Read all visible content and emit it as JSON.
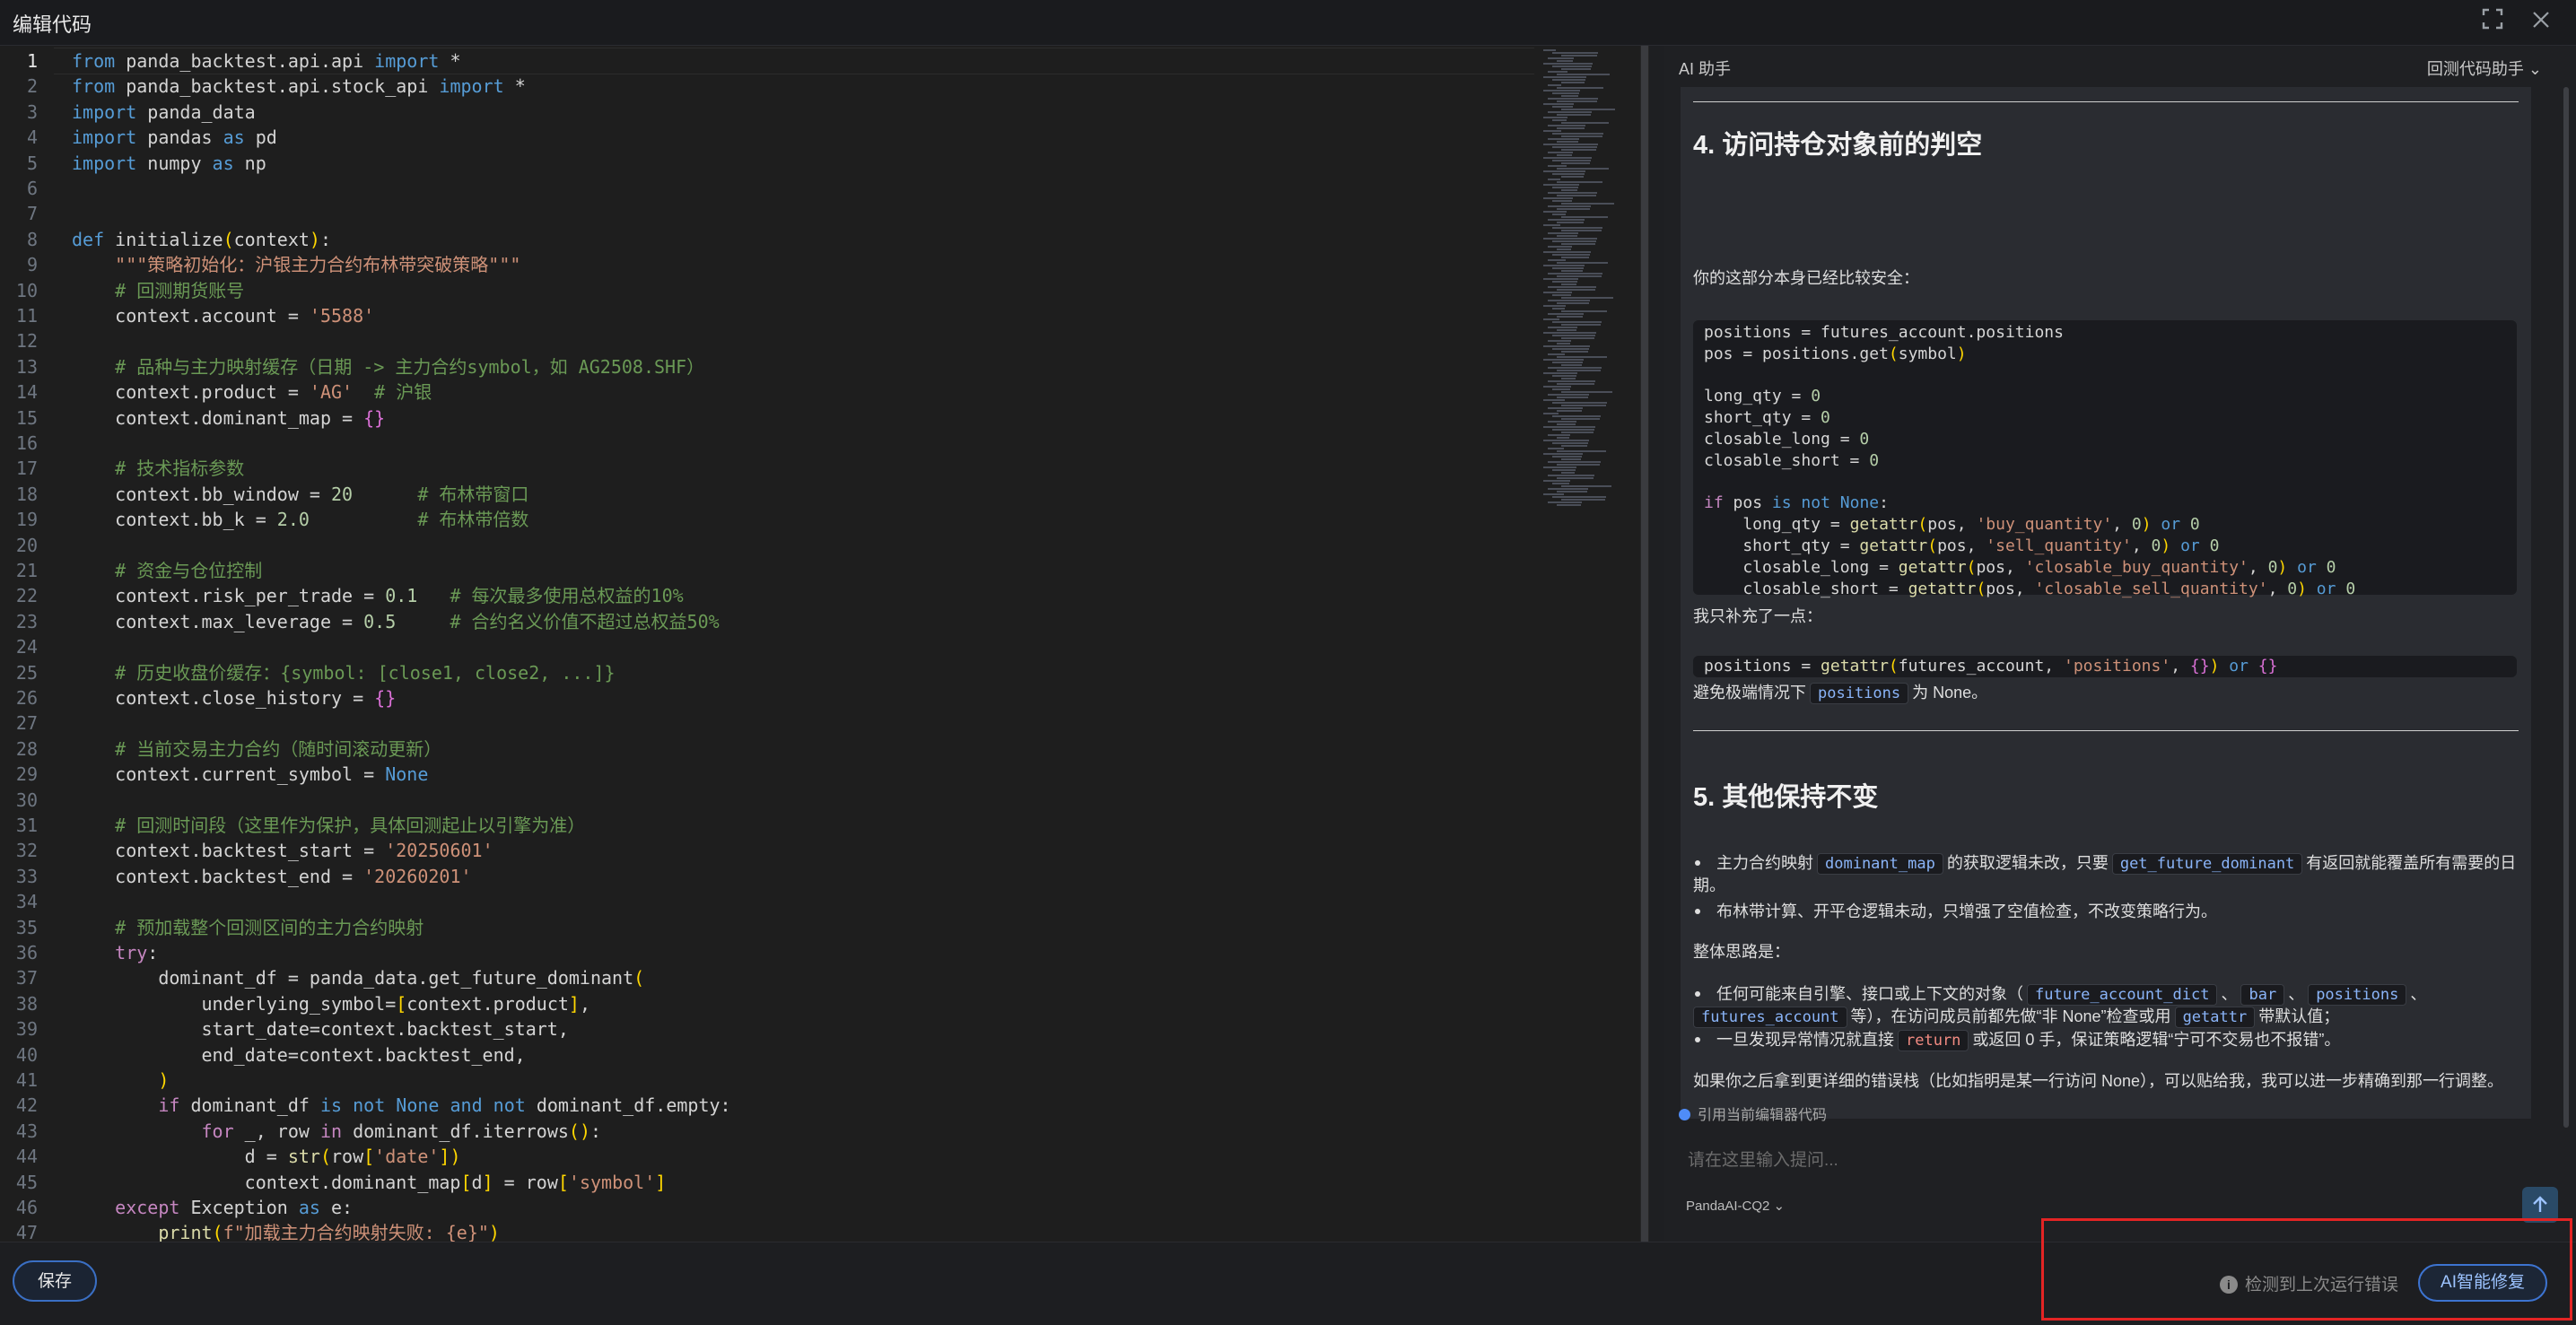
{
  "window": {
    "title": "编辑代码",
    "fullscreen_icon": "fullscreen-icon",
    "close_icon": "close-icon"
  },
  "editor": {
    "active_line": 1,
    "line_numbers": [
      "1",
      "2",
      "3",
      "4",
      "5",
      "6",
      "7",
      "8",
      "9",
      "10",
      "11",
      "12",
      "13",
      "14",
      "15",
      "16",
      "17",
      "18",
      "19",
      "20",
      "21",
      "22",
      "23",
      "24",
      "25",
      "26",
      "27",
      "28",
      "29",
      "30",
      "31",
      "32",
      "33",
      "34",
      "35",
      "36",
      "37",
      "38",
      "39",
      "40",
      "41",
      "42",
      "43",
      "44",
      "45",
      "46",
      "47"
    ],
    "lines": [
      "from panda_backtest.api.api import *",
      "from panda_backtest.api.stock_api import *",
      "import panda_data",
      "import pandas as pd",
      "import numpy as np",
      "",
      "",
      "def initialize(context):",
      "    \"\"\"策略初始化：沪银主力合约布林带突破策略\"\"\"",
      "    # 回测期货账号",
      "    context.account = '5588'",
      "",
      "    # 品种与主力映射缓存（日期 -> 主力合约symbol，如 AG2508.SHF）",
      "    context.product = 'AG'  # 沪银",
      "    context.dominant_map = {}",
      "",
      "    # 技术指标参数",
      "    context.bb_window = 20      # 布林带窗口",
      "    context.bb_k = 2.0          # 布林带倍数",
      "",
      "    # 资金与仓位控制",
      "    context.risk_per_trade = 0.1   # 每次最多使用总权益的10%",
      "    context.max_leverage = 0.5     # 合约名义价值不超过总权益50%",
      "",
      "    # 历史收盘价缓存：{symbol: [close1, close2, ...]}",
      "    context.close_history = {}",
      "",
      "    # 当前交易主力合约（随时间滚动更新）",
      "    context.current_symbol = None",
      "",
      "    # 回测时间段（这里作为保护，具体回测起止以引擎为准）",
      "    context.backtest_start = '20250601'",
      "    context.backtest_end = '20260201'",
      "",
      "    # 预加载整个回测区间的主力合约映射",
      "    try:",
      "        dominant_df = panda_data.get_future_dominant(",
      "            underlying_symbol=[context.product],",
      "            start_date=context.backtest_start,",
      "            end_date=context.backtest_end,",
      "        )",
      "        if dominant_df is not None and not dominant_df.empty:",
      "            for _, row in dominant_df.iterrows():",
      "                d = str(row['date'])",
      "                context.dominant_map[d] = row['symbol']",
      "    except Exception as e:",
      "        print(f\"加载主力合约映射失败: {e}\")"
    ]
  },
  "ai": {
    "header_title": "AI 助手",
    "mode_select": "回测代码助手 ⌄",
    "section4_title": "4. 访问持仓对象前的判空",
    "section4_intro": "你的这部分本身已经比较安全：",
    "code1": [
      "positions = futures_account.positions",
      "pos = positions.get(symbol)",
      "",
      "long_qty = 0",
      "short_qty = 0",
      "closable_long = 0",
      "closable_short = 0",
      "",
      "if pos is not None:",
      "    long_qty = getattr(pos, 'buy_quantity', 0) or 0",
      "    short_qty = getattr(pos, 'sell_quantity', 0) or 0",
      "    closable_long = getattr(pos, 'closable_buy_quantity', 0) or 0",
      "    closable_short = getattr(pos, 'closable_sell_quantity', 0) or 0"
    ],
    "added_text": "我只补充了一点：",
    "code2": "positions = getattr(futures_account, 'positions', {}) or {}",
    "avoid_pre": "避免极端情况下",
    "avoid_code": "positions",
    "avoid_post": "为 None。",
    "section5_title": "5. 其他保持不变",
    "b1_pre": "主力合约映射",
    "b1_code1": "dominant_map",
    "b1_mid": "的获取逻辑未改，只要",
    "b1_code2": "get_future_dominant",
    "b1_post": "有返回就能覆盖所有需要的日",
    "b1_cont": "期。",
    "b2": "布林带计算、开平仓逻辑未动，只增强了空值检查，不改变策略行为。",
    "summary_label": "整体思路是：",
    "b3_pre": "任何可能来自引擎、接口或上下文的对象（",
    "b3_code1": "future_account_dict",
    "b3_sep1": "、",
    "b3_code2": "bar",
    "b3_sep2": "、",
    "b3_code3": "positions",
    "b3_sep3": "、",
    "b3_code4": "futures_account",
    "b3_post": "等），在访问成员前都先做“非 None”检查或用",
    "b3_code5": "getattr",
    "b3_end": "带默认值；",
    "b4_pre": "一旦发现异常情况就直接",
    "b4_code": "return",
    "b4_post": "或返回 0 手，保证策略逻辑“宁可不交易也不报错”。",
    "closing": "如果你之后拿到更详细的错误栈（比如指明是某一行访问 None），可以贴给我，我可以进一步精确到那一行调整。",
    "ref_editor": "引用当前编辑器代码",
    "input_placeholder": "请在这里输入提问...",
    "model": "PandaAI-CQ2 ⌄",
    "send_icon": "arrow-up-icon"
  },
  "footer": {
    "save_label": "保存",
    "error_notice": "检测到上次运行错误",
    "fix_label": "AI智能修复"
  },
  "colors": {
    "accent": "#3d74d1",
    "highlight_box": "#e32424"
  }
}
